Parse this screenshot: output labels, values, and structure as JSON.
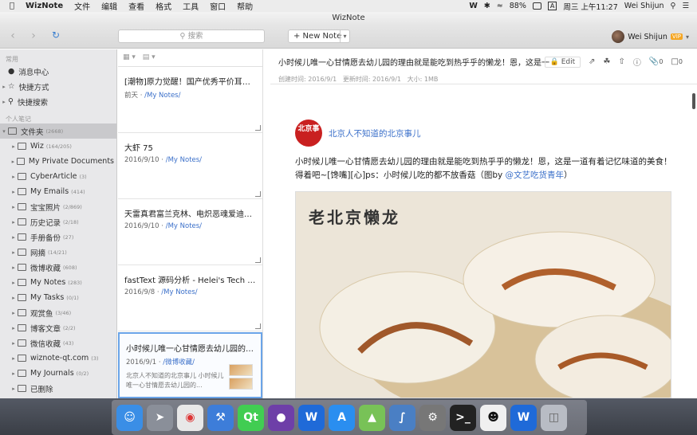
{
  "menubar": {
    "app_name": "WizNote",
    "menus": [
      "文件",
      "编辑",
      "查看",
      "格式",
      "工具",
      "窗口",
      "帮助"
    ],
    "battery": "88%",
    "input_method": "A",
    "datetime": "周三 上午11:27",
    "user": "Wei Shijun"
  },
  "window": {
    "title": "WizNote"
  },
  "toolbar": {
    "search_placeholder": "搜索",
    "new_note": "+ New Note",
    "user_name": "Wei Shijun",
    "vip": "VIP"
  },
  "sidebar": {
    "section_common": "常用",
    "common_items": [
      "消息中心",
      "快捷方式",
      "快捷搜索"
    ],
    "section_personal": "个人笔记",
    "root": {
      "label": "文件夹",
      "count": "(2668)"
    },
    "folders": [
      {
        "label": "Wiz",
        "count": "(164/205)"
      },
      {
        "label": "My Private Documents",
        "count": ""
      },
      {
        "label": "CyberArticle",
        "count": "(3)"
      },
      {
        "label": "My Emails",
        "count": "(414)"
      },
      {
        "label": "宝宝照片",
        "count": "(2/869)"
      },
      {
        "label": "历史记录",
        "count": "(2/18)"
      },
      {
        "label": "手册备份",
        "count": "(27)"
      },
      {
        "label": "网摘",
        "count": "(14/21)"
      },
      {
        "label": "微博收藏",
        "count": "(608)"
      },
      {
        "label": "My Notes",
        "count": "(283)"
      },
      {
        "label": "My Tasks",
        "count": "(0/1)"
      },
      {
        "label": "观赏鱼",
        "count": "(3/46)"
      },
      {
        "label": "博客文章",
        "count": "(2/2)"
      },
      {
        "label": "微信收藏",
        "count": "(43)"
      },
      {
        "label": "wiznote-qt.com",
        "count": "(3)"
      },
      {
        "label": "My Journals",
        "count": "(0/2)"
      },
      {
        "label": "已删除",
        "count": ""
      }
    ]
  },
  "notes": [
    {
      "title": "[潮物]原力觉醒！国产优秀平价耳机推...",
      "date": "前天",
      "folder": "/My Notes/"
    },
    {
      "title": "大虾 75",
      "date": "2016/9/10",
      "folder": "/My Notes/"
    },
    {
      "title": "天雷真君富兰克林、电炽恶魂爱迪生...",
      "date": "2016/9/10",
      "folder": "/My Notes/"
    },
    {
      "title": "fastText 源码分析 - Helei's Tech Not...",
      "date": "2016/9/8",
      "folder": "/My Notes/"
    },
    {
      "title": "小时候儿唯一心甘情愿去幼儿园的理...",
      "date": "2016/9/1",
      "folder": "/微博收藏/",
      "abstract": "北京人不知道的北京事儿 小时候儿唯一心甘情愿去幼儿园的..."
    }
  ],
  "content": {
    "title": "小时候儿唯一心甘情愿去幼儿园的理由就是能吃到热乎乎的懒龙！恩，这是一道...",
    "created": "创建时间: 2016/9/1",
    "updated": "更新时间: 2016/9/1",
    "size": "大小: 1MB",
    "edit": "Edit",
    "attach_count": "0",
    "comment_count": "0",
    "author": "北京人不知道的北京事儿",
    "logo_text": "北京事",
    "body": "小时候儿唯一心甘情愿去幼儿园的理由就是能吃到热乎乎的懒龙！恩，这是一道有着记忆味道的美食！得着吧~[馋嘴][心]ps：小时候儿吃的都不放香菇（图by ",
    "mention": "@文艺吃货青年",
    "body_end": "）",
    "image_caption": "老北京懒龙"
  },
  "dock": [
    "Finder",
    "Launchpad",
    "Chrome",
    "Xcode",
    "Qt",
    "GitHub",
    "WizNote",
    "App Store",
    "Android",
    "Instruments",
    "Preferences",
    "Terminal",
    "QQ",
    "WizNote",
    "Trash"
  ]
}
